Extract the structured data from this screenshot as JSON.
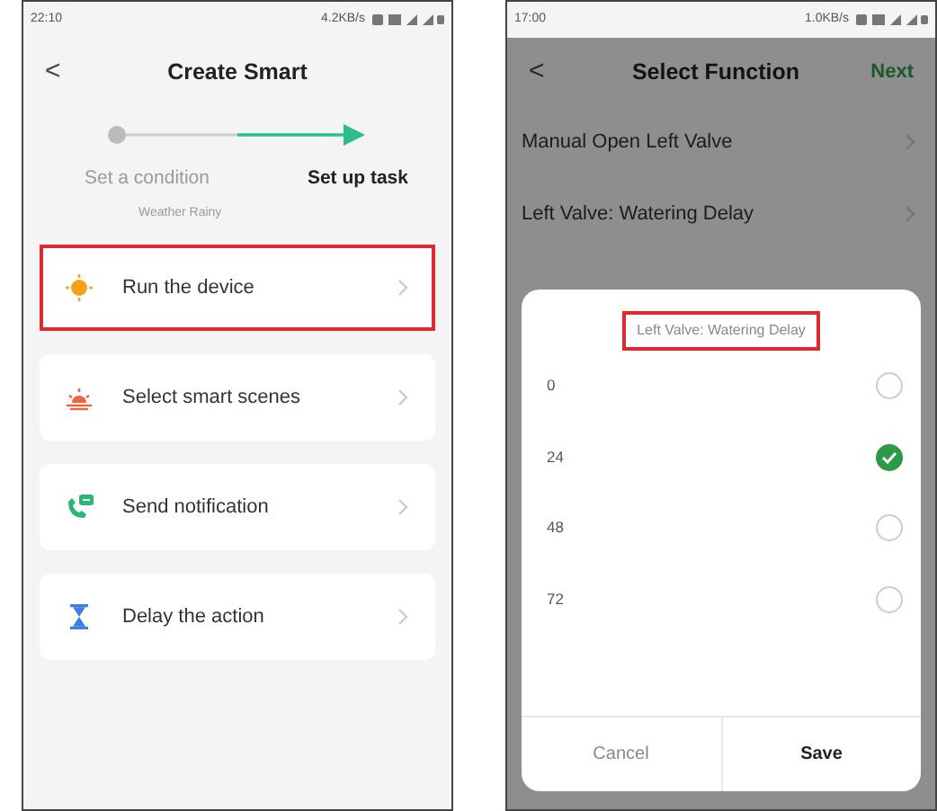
{
  "screens": [
    {
      "status_bar": {
        "time": "22:10",
        "speed": "4.2KB/s"
      },
      "header": {
        "back": "<",
        "title": "Create Smart"
      },
      "steps": [
        {
          "label": "Set a condition",
          "sublabel": "Weather Rainy",
          "selected": false
        },
        {
          "label": "Set up task",
          "selected": true
        }
      ],
      "tasks": [
        {
          "label": "Run the device",
          "kind": "sun",
          "highlighted": true
        },
        {
          "label": "Select smart scenes",
          "kind": "sunset",
          "highlighted": false
        },
        {
          "label": "Send notification",
          "kind": "phone",
          "highlighted": false
        },
        {
          "label": "Delay the action",
          "kind": "hourglass",
          "highlighted": false
        }
      ]
    },
    {
      "status_bar": {
        "time": "17:00",
        "speed": "1.0KB/s"
      },
      "header": {
        "back": "<",
        "title": "Select Function",
        "action": "Next"
      },
      "functions": [
        "Manual Open Left Valve",
        "Left Valve: Watering Delay"
      ],
      "dialog": {
        "title": "Left Valve: Watering Delay",
        "title_highlighted": true,
        "options": [
          {
            "label": "0",
            "selected": false
          },
          {
            "label": "24",
            "selected": true
          },
          {
            "label": "48",
            "selected": false
          },
          {
            "label": "72",
            "selected": false
          }
        ],
        "buttons": [
          "Cancel",
          "Save"
        ]
      }
    }
  ]
}
